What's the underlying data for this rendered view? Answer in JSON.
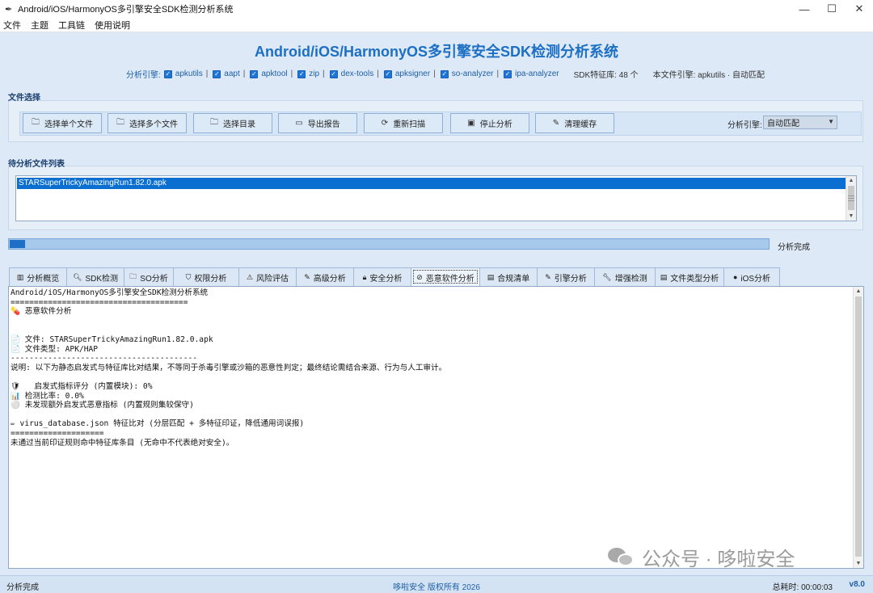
{
  "window": {
    "title": "Android/iOS/HarmonyOS多引擎安全SDK检测分析系统",
    "controls": [
      "—",
      "☐",
      "✕"
    ]
  },
  "menu": [
    "文件",
    "主题",
    "工具链",
    "使用说明"
  ],
  "header": {
    "title": "Android/iOS/HarmonyOS多引擎安全SDK检测分析系统",
    "engines_label": "分析引擎:",
    "engines": [
      "apkutils",
      "aapt",
      "apktool",
      "zip",
      "dex-tools",
      "apksigner",
      "so-analyzer",
      "ipa-analyzer"
    ],
    "sdk_count": "SDK特征库: 48 个",
    "file_engine": "本文件引擎: apkutils · 自动匹配"
  },
  "file_select": {
    "title": "文件选择",
    "buttons": [
      {
        "icon": "folder-icon",
        "label": "选择单个文件"
      },
      {
        "icon": "folder-icon",
        "label": "选择多个文件"
      },
      {
        "icon": "folder-icon",
        "label": "选择目录"
      },
      {
        "icon": "export-icon",
        "label": "导出报告"
      },
      {
        "icon": "rescan-icon",
        "label": "重新扫描"
      },
      {
        "icon": "stop-icon",
        "label": "停止分析"
      },
      {
        "icon": "broom-icon",
        "label": "清理缓存"
      }
    ],
    "engine_label": "分析引擎:",
    "engine_value": "自动匹配"
  },
  "file_list": {
    "title": "待分析文件列表",
    "items": [
      "STARSuperTrickyAmazingRun1.82.0.apk"
    ]
  },
  "progress": {
    "value": 0.02,
    "label": "分析完成"
  },
  "tabs": [
    {
      "icon": "chart-icon",
      "label": "分析概览"
    },
    {
      "icon": "search-icon",
      "label": "SDK检测"
    },
    {
      "icon": "folder-icon",
      "label": "SO分析"
    },
    {
      "icon": "shield-icon",
      "label": "权限分析"
    },
    {
      "icon": "warning-icon",
      "label": "风险评估"
    },
    {
      "icon": "pencil-icon",
      "label": "高级分析"
    },
    {
      "icon": "lock-icon",
      "label": "安全分析"
    },
    {
      "icon": "pill-icon",
      "label": "恶意软件分析",
      "active": true
    },
    {
      "icon": "clipboard-icon",
      "label": "合规清单"
    },
    {
      "icon": "pencil-icon",
      "label": "引擎分析"
    },
    {
      "icon": "wrench-icon",
      "label": "增强检测"
    },
    {
      "icon": "document-icon",
      "label": "文件类型分析"
    },
    {
      "icon": "apple-icon",
      "label": "iOS分析"
    }
  ],
  "output": {
    "lines": [
      "Android/iOS/HarmonyOS多引擎安全SDK检测分析系统",
      "======================================",
      "💊 恶意软件分析",
      "",
      "",
      "📄 文件: STARSuperTrickyAmazingRun1.82.0.apk",
      "📄 文件类型: APK/HAP",
      "----------------------------------------",
      "说明: 以下为静态启发式与特征库比对结果，不等同于杀毒引擎或沙箱的恶意性判定；最终结论需结合来源、行为与人工审计。",
      "",
      "🛡   启发式指标评分 (内置模块): 0%",
      "📊 检测比率: 0.0%",
      "⚪ 未发现额外启发式恶意指标 (内置规则集较保守)",
      "",
      "✏ virus_database.json 特征比对 (分层匹配 + 多特征印证，降低通用词误报)",
      "====================",
      "未通过当前印证规则命中特征库条目 (无命中不代表绝对安全)。"
    ]
  },
  "watermark": {
    "text": "公众号 · 哆啦安全"
  },
  "status": {
    "left": "分析完成",
    "center": "哆啦安全 版权所有 2026",
    "time": "总耗时: 00:00:03",
    "version": "v8.0"
  }
}
